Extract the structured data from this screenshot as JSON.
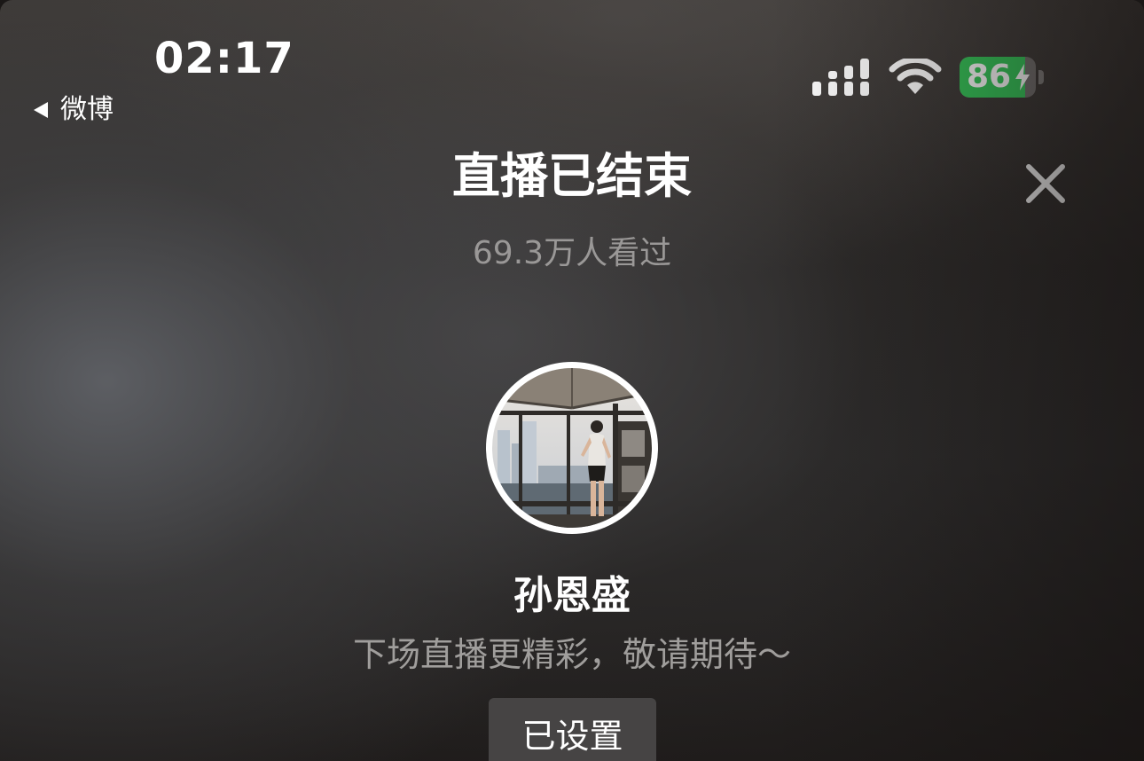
{
  "status_bar": {
    "time": "02:17",
    "back_app": "微博",
    "battery_level": "86",
    "battery_fraction": 0.86,
    "signal_icon": "cellular-signal-icon",
    "wifi_icon": "wifi-icon",
    "battery_icon": "battery-charging-icon"
  },
  "header": {
    "title": "直播已结束",
    "viewers": "69.3万人看过",
    "close_icon": "close-icon"
  },
  "host": {
    "name": "孙恩盛",
    "message": "下场直播更精彩，敬请期待～",
    "reminder_button": "已设置"
  },
  "colors": {
    "battery_green": "#35c759",
    "muted_text": "#9a9897",
    "button_bg": "#464444"
  }
}
